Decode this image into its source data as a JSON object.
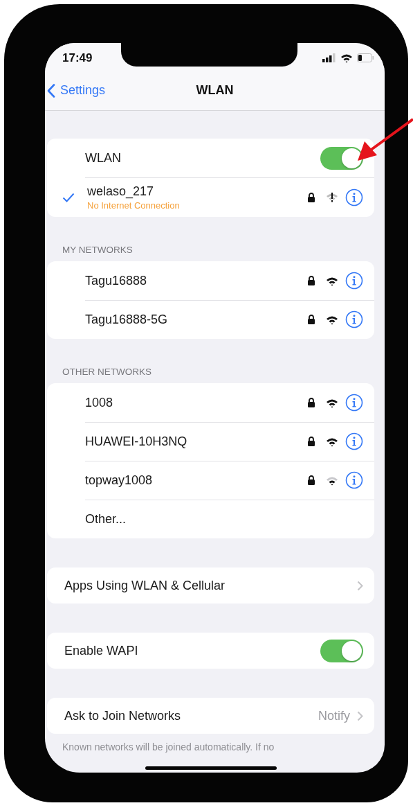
{
  "status_bar": {
    "time": "17:49"
  },
  "nav": {
    "back": "Settings",
    "title": "WLAN"
  },
  "wlan": {
    "label": "WLAN",
    "on": true
  },
  "current_network": {
    "name": "welaso_217",
    "status": "No Internet Connection",
    "checked": true,
    "secured": true,
    "no_internet": true
  },
  "sections": [
    {
      "header": "MY NETWORKS",
      "networks": [
        {
          "name": "Tagu16888",
          "secured": true,
          "weak_signal": false
        },
        {
          "name": "Tagu16888-5G",
          "secured": true,
          "weak_signal": false
        }
      ]
    },
    {
      "header": "OTHER NETWORKS",
      "networks": [
        {
          "name": "1008",
          "secured": true,
          "weak_signal": false
        },
        {
          "name": "HUAWEI-10H3NQ",
          "secured": true,
          "weak_signal": false
        },
        {
          "name": "topway1008",
          "secured": true,
          "weak_signal": true
        }
      ],
      "other": "Other..."
    }
  ],
  "settings": [
    {
      "kind": "link",
      "label": "Apps Using WLAN & Cellular"
    },
    {
      "kind": "toggle",
      "label": "Enable WAPI",
      "on": true
    },
    {
      "kind": "value",
      "label": "Ask to Join Networks",
      "value": "Notify"
    }
  ],
  "footer": "Known networks will be joined automatically. If no",
  "annotations": [
    {
      "kind": "arrow"
    }
  ]
}
